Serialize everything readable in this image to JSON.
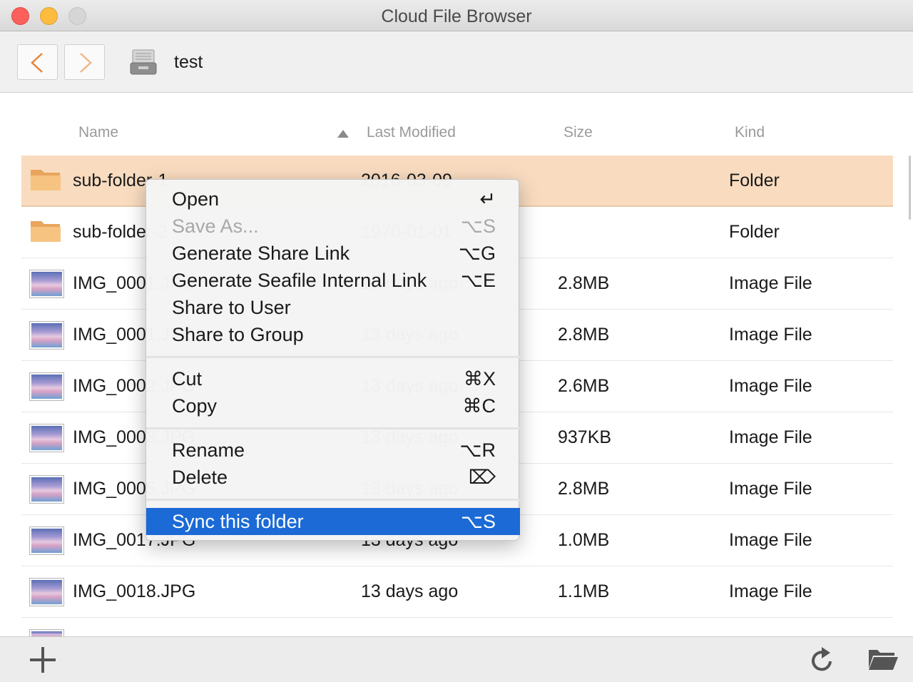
{
  "window": {
    "title": "Cloud File Browser"
  },
  "toolbar": {
    "breadcrumb": "test"
  },
  "table": {
    "columns": {
      "name": "Name",
      "modified": "Last Modified",
      "size": "Size",
      "kind": "Kind"
    },
    "rows": [
      {
        "name": "sub-folder-1",
        "modified": "2016-03-09",
        "size": "",
        "kind": "Folder",
        "type": "folder",
        "selected": true
      },
      {
        "name": "sub-folder-2",
        "modified": "1970-01-01",
        "size": "",
        "kind": "Folder",
        "type": "folder"
      },
      {
        "name": "IMG_0001.JPG",
        "modified": "13 days ago",
        "size": "2.8MB",
        "kind": "Image File",
        "type": "image"
      },
      {
        "name": "IMG_0001.JPG",
        "modified": "13 days ago",
        "size": "2.8MB",
        "kind": "Image File",
        "type": "image"
      },
      {
        "name": "IMG_0002.JPG",
        "modified": "13 days ago",
        "size": "2.6MB",
        "kind": "Image File",
        "type": "image"
      },
      {
        "name": "IMG_0003.JPG",
        "modified": "13 days ago",
        "size": "937KB",
        "kind": "Image File",
        "type": "image"
      },
      {
        "name": "IMG_0005.JPG",
        "modified": "13 days ago",
        "size": "2.8MB",
        "kind": "Image File",
        "type": "image"
      },
      {
        "name": "IMG_0017.JPG",
        "modified": "13 days ago",
        "size": "1.0MB",
        "kind": "Image File",
        "type": "image"
      },
      {
        "name": "IMG_0018.JPG",
        "modified": "13 days ago",
        "size": "1.1MB",
        "kind": "Image File",
        "type": "image"
      }
    ]
  },
  "context_menu": {
    "items": [
      {
        "label": "Open",
        "shortcut": "↵"
      },
      {
        "label": "Save As...",
        "shortcut": "⌥S",
        "disabled": true
      },
      {
        "label": "Generate Share Link",
        "shortcut": "⌥G"
      },
      {
        "label": "Generate Seafile Internal Link",
        "shortcut": "⌥E"
      },
      {
        "label": "Share to User",
        "shortcut": ""
      },
      {
        "label": "Share to Group",
        "shortcut": ""
      },
      {
        "label": "Cut",
        "shortcut": "⌘X"
      },
      {
        "label": "Copy",
        "shortcut": "⌘C"
      },
      {
        "label": "Rename",
        "shortcut": "⌥R"
      },
      {
        "label": "Delete",
        "shortcut": "⌦"
      },
      {
        "label": "Sync this folder",
        "shortcut": "⌥S",
        "highlighted": true
      }
    ]
  },
  "colors": {
    "accent": "#e8843a",
    "selection": "#f9dcc0",
    "menu_highlight": "#1b6ad6"
  },
  "icons": {
    "back": "chevron-left-icon",
    "forward": "chevron-right-icon",
    "drive": "drive-icon",
    "folder": "folder-icon",
    "image": "image-thumbnail-icon",
    "add": "plus-icon",
    "refresh": "refresh-icon",
    "open_folder": "open-folder-icon"
  }
}
